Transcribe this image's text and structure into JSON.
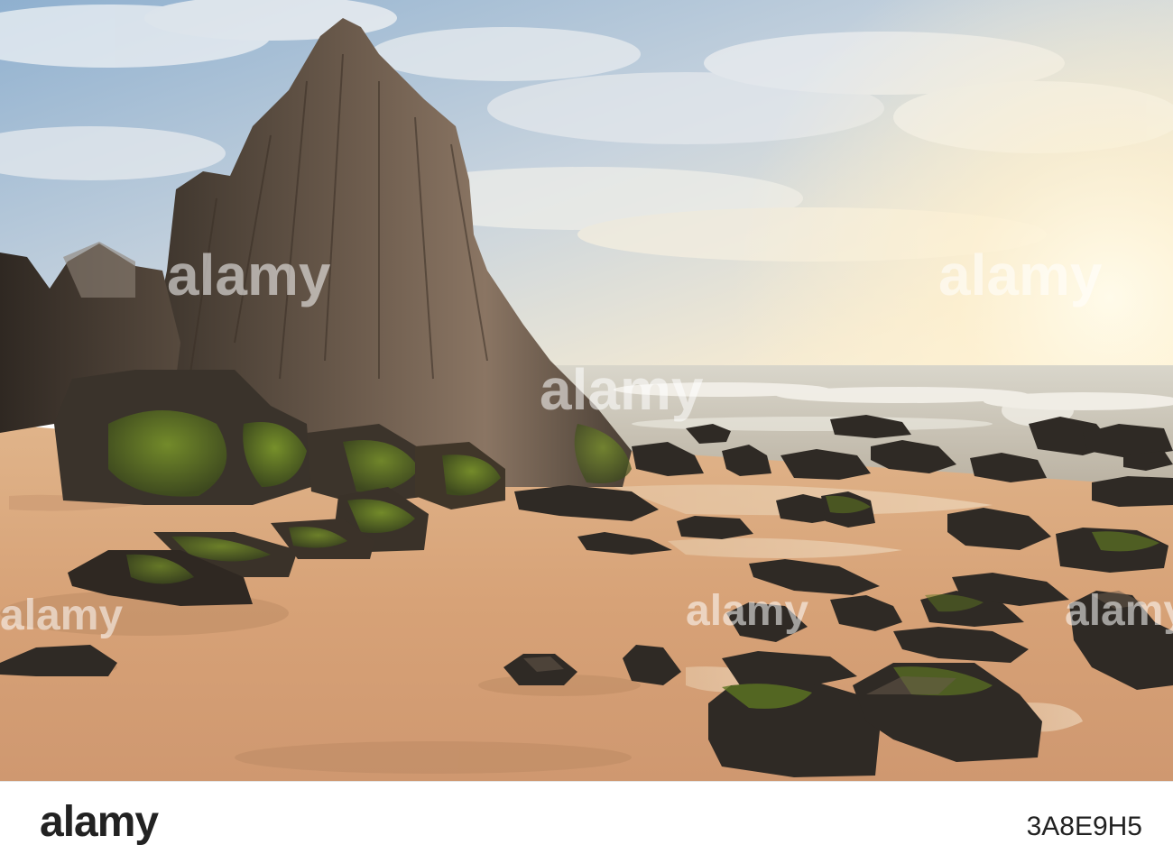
{
  "photo": {
    "subject": "coastal-scene",
    "watermarks": [
      "alamy",
      "alamy",
      "alamy",
      "alamy",
      "alamy",
      "alamy"
    ]
  },
  "footer": {
    "logo_text": "alamy",
    "image_id": "3A8E9H5"
  },
  "colors": {
    "sky_top": "#9db7d2",
    "sky_glow": "#fbf1d6",
    "sand": "#d9a57a",
    "rock_dark": "#3a322a",
    "moss": "#5e7a1e"
  }
}
